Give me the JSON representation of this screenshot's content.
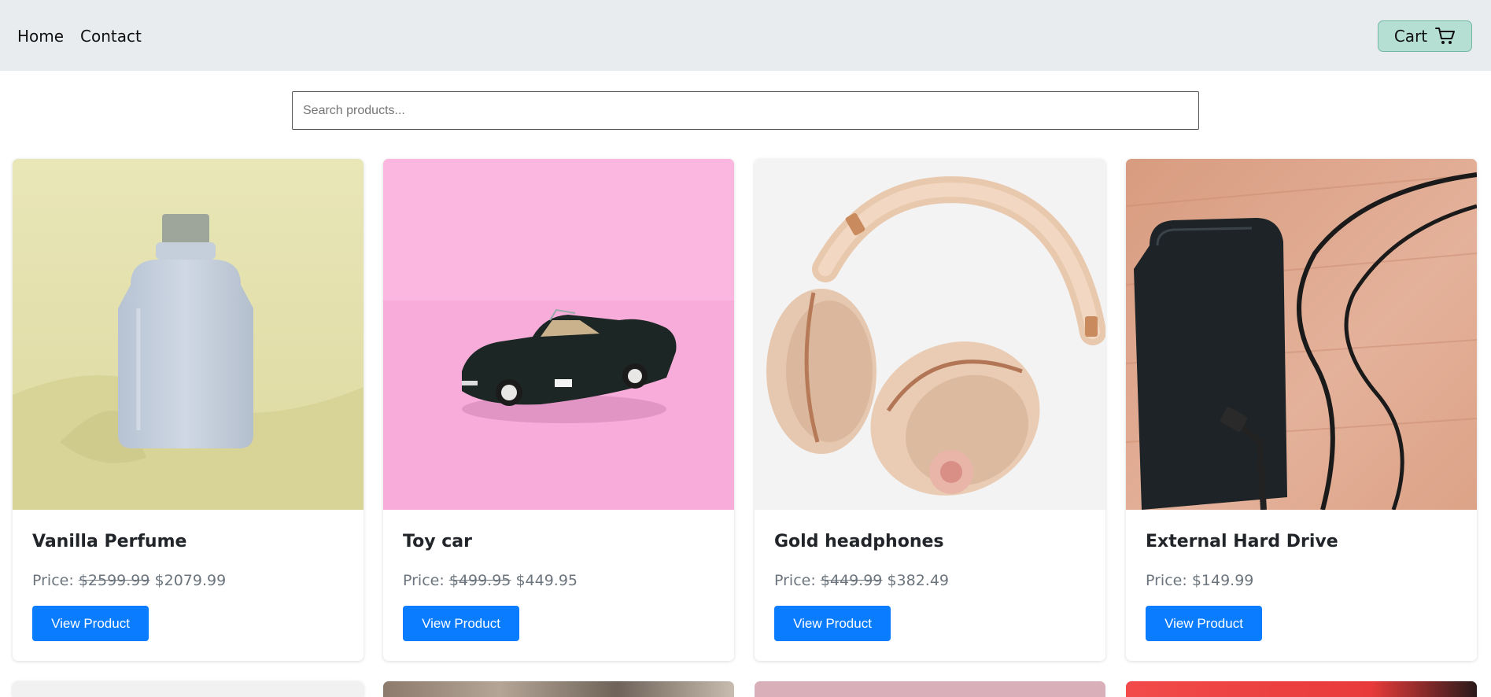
{
  "nav": {
    "home_label": "Home",
    "contact_label": "Contact",
    "cart_label": "Cart"
  },
  "search": {
    "placeholder": "Search products..."
  },
  "colors": {
    "navbar_bg": "#e9ecef",
    "cart_bg": "#b5dfd3",
    "primary_button": "#0a7cff",
    "price_text": "#6c757d"
  },
  "products": [
    {
      "name": "Vanilla Perfume",
      "price_label": "Price:",
      "old_price": "$2599.99",
      "price": "$2079.99",
      "button": "View Product"
    },
    {
      "name": "Toy car",
      "price_label": "Price:",
      "old_price": "$499.95",
      "price": "$449.95",
      "button": "View Product"
    },
    {
      "name": "Gold headphones",
      "price_label": "Price:",
      "old_price": "$449.99",
      "price": "$382.49",
      "button": "View Product"
    },
    {
      "name": "External Hard Drive",
      "price_label": "Price:",
      "price": "$149.99",
      "button": "View Product"
    }
  ]
}
